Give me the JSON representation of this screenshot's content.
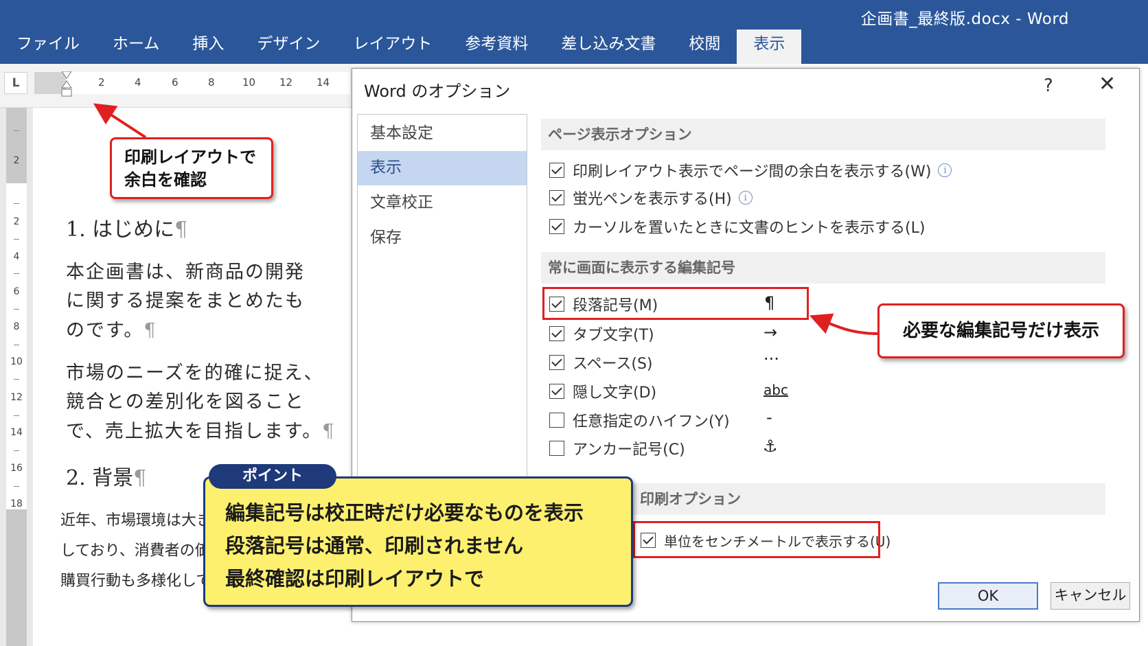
{
  "window": {
    "title": "企画書_最終版.docx  -  Word"
  },
  "ribbon": {
    "tabs": [
      "ファイル",
      "ホーム",
      "挿入",
      "デザイン",
      "レイアウト",
      "参考資料",
      "差し込み文書",
      "校閲",
      "表示"
    ],
    "active_tab": "表示"
  },
  "ruler": {
    "corner": "L",
    "horizontal": [
      "2",
      "4",
      "6",
      "8",
      "10",
      "12",
      "14"
    ],
    "vertical": [
      "2",
      "2",
      "4",
      "6",
      "8",
      "10",
      "12",
      "14",
      "16",
      "18"
    ]
  },
  "document": {
    "heading1": "1. はじめに",
    "para1": [
      "本企画書は、新商品の開発",
      "に関する提案をまとめたも",
      "のです。"
    ],
    "para2": [
      "市場のニーズを的確に捉え、",
      "競合との差別化を図ること",
      "で、売上拡大を目指します。"
    ],
    "heading2": "2. 背景",
    "para3": [
      "近年、市場環境は大き",
      "しており、消費者の価値観",
      "購買行動も多様化していま"
    ],
    "pilcrow": "¶"
  },
  "dialog": {
    "title": "Word のオプション",
    "help": "?",
    "close": "✕",
    "nav": [
      "基本設定",
      "表示",
      "文章校正",
      "保存"
    ],
    "nav_selected": "表示",
    "sections": {
      "page_display": {
        "title": "ページ表示オプション",
        "options": [
          {
            "label": "印刷レイアウト表示でページ間の余白を表示する(W)",
            "checked": true,
            "info": true
          },
          {
            "label": "蛍光ペンを表示する(H)",
            "checked": true,
            "info": true
          },
          {
            "label": "カーソルを置いたときに文書のヒントを表示する(L)",
            "checked": true,
            "info": false
          }
        ]
      },
      "formatting_marks": {
        "title": "常に画面に表示する編集記号",
        "options": [
          {
            "label": "段落記号(M)",
            "checked": true,
            "symbol": "¶"
          },
          {
            "label": "タブ文字(T)",
            "checked": true,
            "symbol": "→"
          },
          {
            "label": "スペース(S)",
            "checked": true,
            "symbol": "···"
          },
          {
            "label": "隠し文字(D)",
            "checked": true,
            "symbol": "abc"
          },
          {
            "label": "任意指定のハイフン(Y)",
            "checked": false,
            "symbol": "-"
          },
          {
            "label": "アンカー記号(C)",
            "checked": false,
            "symbol": "⚓"
          }
        ]
      },
      "print": {
        "title": "印刷オプション",
        "options": [
          {
            "label": "単位をセンチメートルで表示する(U)",
            "checked": true
          }
        ]
      }
    },
    "buttons": {
      "ok": "OK",
      "cancel": "キャンセル"
    }
  },
  "annotations": {
    "margin_callout": [
      "印刷レイアウトで",
      "余白を確認"
    ],
    "marks_callout": "必要な編集記号だけ表示",
    "point_tag": "ポイント",
    "point_lines": [
      "編集記号は校正時だけ必要なものを表示",
      "段落記号は通常、印刷されません",
      "最終確認は印刷レイアウトで"
    ]
  },
  "colors": {
    "ribbon": "#2b579a",
    "highlight_red": "#e02020",
    "point_bg": "#fdf06f",
    "point_border": "#1f3a7a",
    "nav_selected": "#c5d7f0"
  }
}
